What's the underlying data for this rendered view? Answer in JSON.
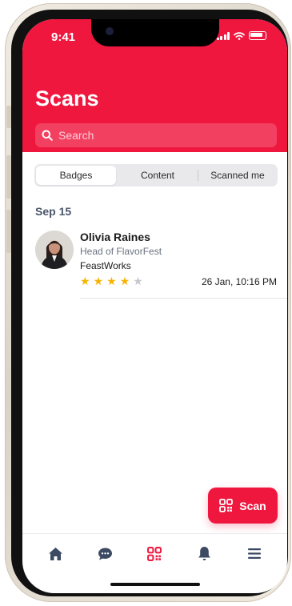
{
  "status_bar": {
    "time": "9:41"
  },
  "header": {
    "title": "Scans",
    "search_placeholder": "Search"
  },
  "tabs": [
    {
      "label": "Badges",
      "active": true
    },
    {
      "label": "Content",
      "active": false
    },
    {
      "label": "Scanned me",
      "active": false
    }
  ],
  "section": {
    "date": "Sep 15"
  },
  "contact": {
    "name": "Olivia Raines",
    "role": "Head of FlavorFest",
    "company": "FeastWorks",
    "rating": 4,
    "rating_max": 5,
    "scanned_at": "26 Jan, 10:16 PM"
  },
  "fab": {
    "label": "Scan",
    "icon": "qr-code-icon"
  },
  "bottom_nav": [
    {
      "icon": "home-icon",
      "active": false
    },
    {
      "icon": "chat-icon",
      "active": false
    },
    {
      "icon": "qr-code-icon",
      "active": true
    },
    {
      "icon": "bell-icon",
      "active": false
    },
    {
      "icon": "menu-icon",
      "active": false
    }
  ],
  "colors": {
    "accent": "#f0173f",
    "star": "#f5b400",
    "nav_icon": "#3c4a63"
  }
}
